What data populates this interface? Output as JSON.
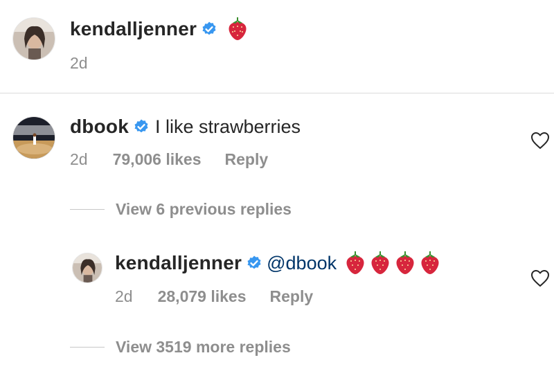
{
  "caption": {
    "username": "kendalljenner",
    "time": "2d",
    "emoji_icon": "strawberry-emoji",
    "emoji_count": 1
  },
  "comment": {
    "username": "dbook",
    "text": "I like strawberries",
    "time": "2d",
    "likes": "79,006 likes",
    "reply_label": "Reply",
    "like_icon": "heart-outline-icon"
  },
  "view_previous": {
    "label": "View 6 previous replies"
  },
  "reply": {
    "username": "kendalljenner",
    "mention": "@dbook",
    "emoji_icon": "strawberry-emoji",
    "emoji_count": 4,
    "time": "2d",
    "likes": "28,079 likes",
    "reply_label": "Reply",
    "like_icon": "heart-outline-icon"
  },
  "view_more": {
    "label": "View 3519 more replies"
  },
  "colors": {
    "verified": "#3897f0",
    "mention": "#003569",
    "meta": "#8e8e8e",
    "strawberry": "#d7263d"
  }
}
